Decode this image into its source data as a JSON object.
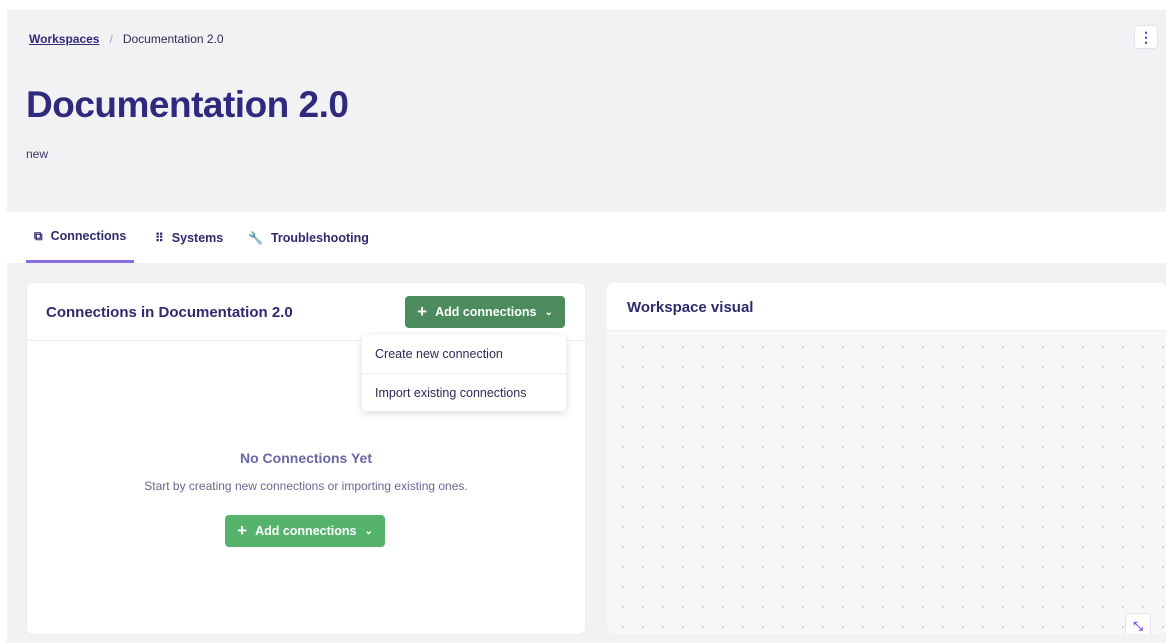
{
  "breadcrumb": {
    "root": "Workspaces",
    "separator": "/",
    "current": "Documentation 2.0"
  },
  "header": {
    "title": "Documentation 2.0",
    "description": "new",
    "menu_icon": "more-vertical-icon"
  },
  "tabs": [
    {
      "label": "Connections",
      "icon": "copy-icon",
      "active": true
    },
    {
      "label": "Systems",
      "icon": "grid-dots-icon",
      "active": false
    },
    {
      "label": "Troubleshooting",
      "icon": "wrench-icon",
      "active": false
    }
  ],
  "connections_panel": {
    "title": "Connections in Documentation 2.0",
    "add_button": "Add connections",
    "dropdown": [
      "Create new connection",
      "Import existing connections"
    ],
    "empty_title": "No Connections Yet",
    "empty_text": "Start by creating new connections or importing existing ones.",
    "empty_button": "Add connections"
  },
  "visual_panel": {
    "title": "Workspace visual"
  },
  "colors": {
    "accent": "#2f2a7e",
    "green_dark": "#4b8b5e",
    "green": "#55b36c",
    "tab_underline": "#8a6fe0"
  }
}
